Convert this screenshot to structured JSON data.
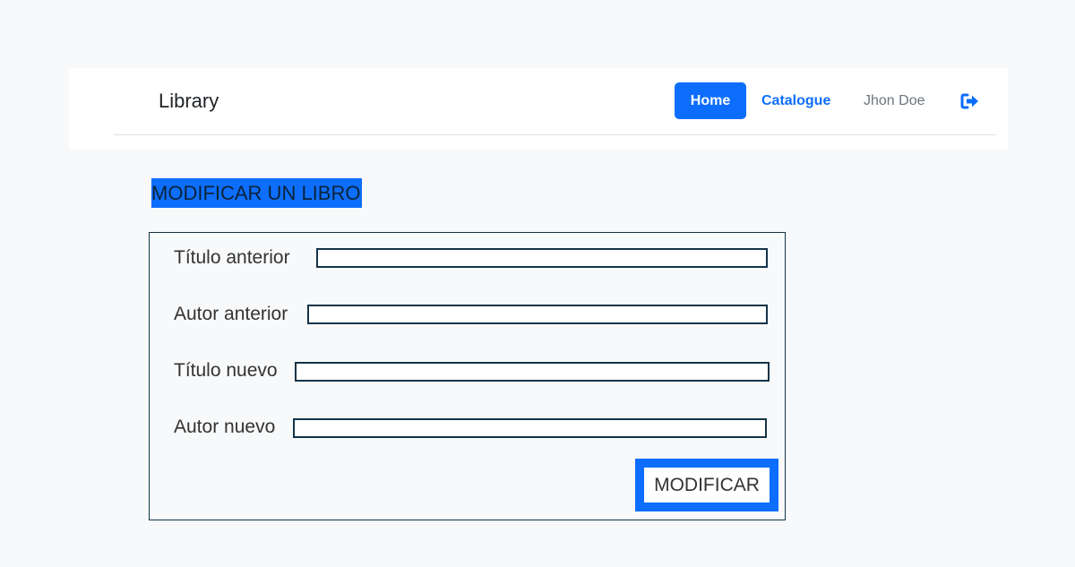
{
  "navbar": {
    "brand": "Library",
    "links": {
      "home": "Home",
      "catalogue": "Catalogue"
    },
    "user": "Jhon Doe",
    "logout_icon": "sign-out-icon",
    "colors": {
      "primary": "#0d6efd",
      "muted": "#6c757d"
    }
  },
  "page": {
    "title": "MODIFICAR UN LIBRO"
  },
  "form": {
    "fields": [
      {
        "label": "Título anterior",
        "value": ""
      },
      {
        "label": "Autor anterior",
        "value": ""
      },
      {
        "label": "Título nuevo",
        "value": ""
      },
      {
        "label": "Autor nuevo",
        "value": ""
      }
    ],
    "submit_label": "MODIFICAR"
  }
}
